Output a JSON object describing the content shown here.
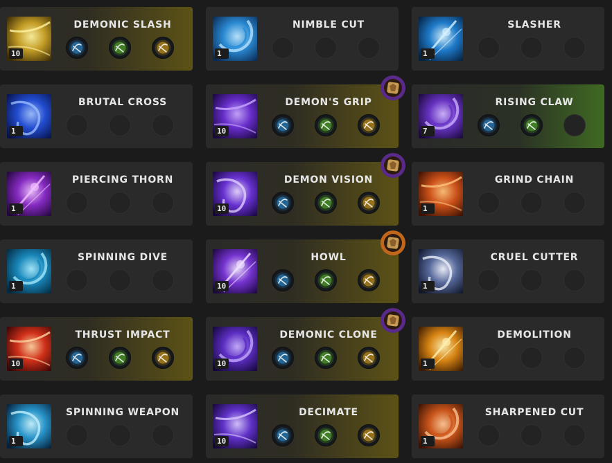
{
  "skills": [
    {
      "name": "DEMONIC SLASH",
      "level": "10",
      "icon": "demonic-slash-icon",
      "palette": [
        "#3a2a05",
        "#c9a227",
        "#fff3a0"
      ],
      "tier": "gold",
      "rune": null,
      "tripods": [
        {
          "icon": "dash-figure-icon",
          "color": "#2e8fd6"
        },
        {
          "icon": "green-burst-icon",
          "color": "#59b52c"
        },
        {
          "icon": "gold-chevrons-icon",
          "color": "#d9a21a"
        }
      ]
    },
    {
      "name": "NIMBLE CUT",
      "level": "1",
      "icon": "nimble-cut-icon",
      "palette": [
        "#0a2a55",
        "#2c8fd9",
        "#bfe8ff"
      ],
      "tier": null,
      "rune": null,
      "tripods": []
    },
    {
      "name": "SLASHER",
      "level": "1",
      "icon": "slasher-icon",
      "palette": [
        "#062040",
        "#1f7fd0",
        "#d6f2ff"
      ],
      "tier": null,
      "rune": null,
      "tripods": []
    },
    {
      "name": "BRUTAL CROSS",
      "level": "1",
      "icon": "brutal-cross-icon",
      "palette": [
        "#06124a",
        "#2450d8",
        "#9fc0ff"
      ],
      "tier": null,
      "rune": null,
      "tripods": []
    },
    {
      "name": "DEMON'S GRIP",
      "level": "10",
      "icon": "demons-grip-icon",
      "palette": [
        "#1a0640",
        "#6a2fd0",
        "#c9a8ff"
      ],
      "tier": "gold",
      "rune": "purple",
      "tripods": [
        {
          "icon": "blue-downward-icon",
          "color": "#2e8fd6"
        },
        {
          "icon": "green-burst-icon",
          "color": "#59b52c"
        },
        {
          "icon": "gold-claw-icon",
          "color": "#d9a21a"
        }
      ]
    },
    {
      "name": "RISING CLAW",
      "level": "7",
      "icon": "rising-claw-icon",
      "palette": [
        "#1a0838",
        "#6a35c8",
        "#d0b6ff"
      ],
      "tier": "green",
      "rune": null,
      "tripods": [
        {
          "icon": "blue-figure-icon",
          "color": "#2e8fd6"
        },
        {
          "icon": "green-target-icon",
          "color": "#59b52c"
        }
      ]
    },
    {
      "name": "PIERCING THORN",
      "level": "1",
      "icon": "piercing-thorn-icon",
      "palette": [
        "#22063a",
        "#8a2cc8",
        "#f0c0ff"
      ],
      "tier": null,
      "rune": null,
      "tripods": []
    },
    {
      "name": "DEMON VISION",
      "level": "10",
      "icon": "demon-vision-icon",
      "palette": [
        "#180540",
        "#6b34d8",
        "#e6d6ff"
      ],
      "tier": "gold",
      "rune": "purple",
      "tripods": [
        {
          "icon": "blue-download-icon",
          "color": "#2e8fd6"
        },
        {
          "icon": "green-burst-icon",
          "color": "#59b52c"
        },
        {
          "icon": "gold-cross-icon",
          "color": "#d9a21a"
        }
      ]
    },
    {
      "name": "GRIND CHAIN",
      "level": "1",
      "icon": "grind-chain-icon",
      "palette": [
        "#3a1002",
        "#d2531a",
        "#ffc27a"
      ],
      "tier": null,
      "rune": null,
      "tripods": []
    },
    {
      "name": "SPINNING DIVE",
      "level": "1",
      "icon": "spinning-dive-icon",
      "palette": [
        "#032a40",
        "#1a8cc0",
        "#a8ecff"
      ],
      "tier": null,
      "rune": null,
      "tripods": []
    },
    {
      "name": "HOWL",
      "level": "10",
      "icon": "howl-icon",
      "palette": [
        "#1c0640",
        "#7a36d8",
        "#f0e2ff"
      ],
      "tier": "gold",
      "rune": "orange",
      "tripods": [
        {
          "icon": "blue-speed-icon",
          "color": "#2e8fd6"
        },
        {
          "icon": "green-burst-icon",
          "color": "#59b52c"
        },
        {
          "icon": "gold-orb-icon",
          "color": "#d9a21a"
        }
      ]
    },
    {
      "name": "CRUEL CUTTER",
      "level": "1",
      "icon": "cruel-cutter-icon",
      "palette": [
        "#10162a",
        "#5a6ca0",
        "#f2f5ff"
      ],
      "tier": null,
      "rune": null,
      "tripods": []
    },
    {
      "name": "THRUST IMPACT",
      "level": "10",
      "icon": "thrust-impact-icon",
      "palette": [
        "#3a0505",
        "#d8321a",
        "#ffd2a0"
      ],
      "tier": "gold",
      "rune": null,
      "tripods": [
        {
          "icon": "blue-sword-icon",
          "color": "#2e8fd6"
        },
        {
          "icon": "green-spark-icon",
          "color": "#59b52c"
        },
        {
          "icon": "gold-claw-icon",
          "color": "#d9a21a"
        }
      ]
    },
    {
      "name": "DEMONIC CLONE",
      "level": "10",
      "icon": "demonic-clone-icon",
      "palette": [
        "#14063a",
        "#5f30c8",
        "#c8b0ff"
      ],
      "tier": "gold",
      "rune": "purple",
      "tripods": [
        {
          "icon": "blue-slash-icon",
          "color": "#2e8fd6"
        },
        {
          "icon": "green-cross-icon",
          "color": "#59b52c"
        },
        {
          "icon": "gold-claw-icon",
          "color": "#d9a21a"
        }
      ]
    },
    {
      "name": "DEMOLITION",
      "level": "1",
      "icon": "demolition-icon",
      "palette": [
        "#3a1a02",
        "#e08a14",
        "#fff0b0"
      ],
      "tier": null,
      "rune": null,
      "tripods": []
    },
    {
      "name": "SPINNING WEAPON",
      "level": "1",
      "icon": "spinning-weapon-icon",
      "palette": [
        "#04203a",
        "#2a9ad0",
        "#c8f4ff"
      ],
      "tier": null,
      "rune": null,
      "tripods": []
    },
    {
      "name": "DECIMATE",
      "level": "10",
      "icon": "decimate-icon",
      "palette": [
        "#16063c",
        "#6434d0",
        "#d8c6ff"
      ],
      "tier": "gold",
      "rune": null,
      "tripods": [
        {
          "icon": "blue-speed-icon",
          "color": "#2e8fd6"
        },
        {
          "icon": "green-beast-icon",
          "color": "#59b52c"
        },
        {
          "icon": "gold-fist-icon",
          "color": "#d9a21a"
        }
      ]
    },
    {
      "name": "SHARPENED CUT",
      "level": "1",
      "icon": "sharpened-cut-icon",
      "palette": [
        "#3a1204",
        "#d0581c",
        "#ffc898"
      ],
      "tier": null,
      "rune": null,
      "tripods": []
    }
  ]
}
